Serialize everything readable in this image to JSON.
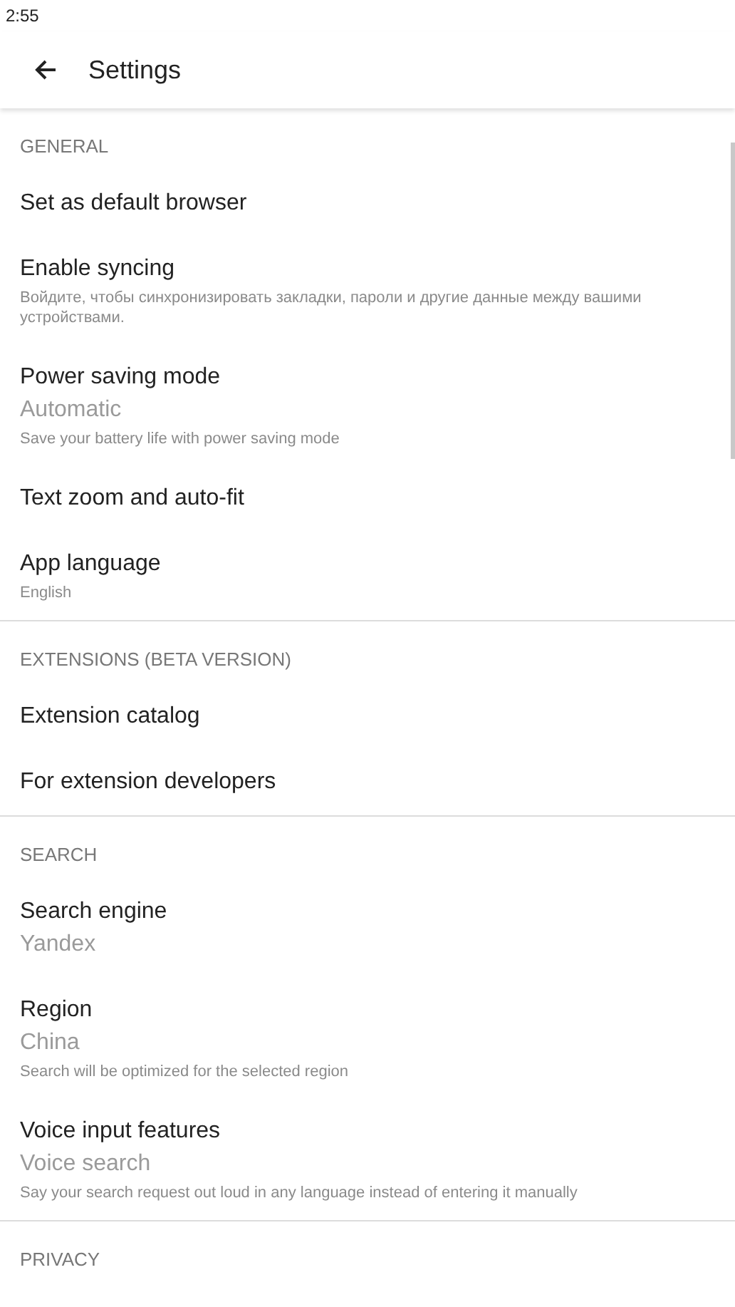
{
  "status_bar": {
    "time": "2:55"
  },
  "app_bar": {
    "title": "Settings"
  },
  "sections": [
    {
      "header": "GENERAL",
      "items": [
        {
          "title": "Set as default browser"
        },
        {
          "title": "Enable syncing",
          "note": "Войдите, чтобы синхронизировать закладки, пароли и другие данные между вашими устройствами."
        },
        {
          "title": "Power saving mode",
          "value": "Automatic",
          "note": "Save your battery life with power saving mode"
        },
        {
          "title": "Text zoom and auto-fit"
        },
        {
          "title": "App language",
          "note": "English"
        }
      ]
    },
    {
      "header": "EXTENSIONS (BETA VERSION)",
      "items": [
        {
          "title": "Extension catalog"
        },
        {
          "title": "For extension developers"
        }
      ]
    },
    {
      "header": "SEARCH",
      "items": [
        {
          "title": "Search engine",
          "value": "Yandex"
        },
        {
          "title": "Region",
          "value": "China",
          "note": "Search will be optimized for the selected region"
        },
        {
          "title": "Voice input features",
          "value": "Voice search",
          "note": "Say your search request out loud in any language instead of entering it manually"
        }
      ]
    },
    {
      "header": "PRIVACY"
    }
  ]
}
